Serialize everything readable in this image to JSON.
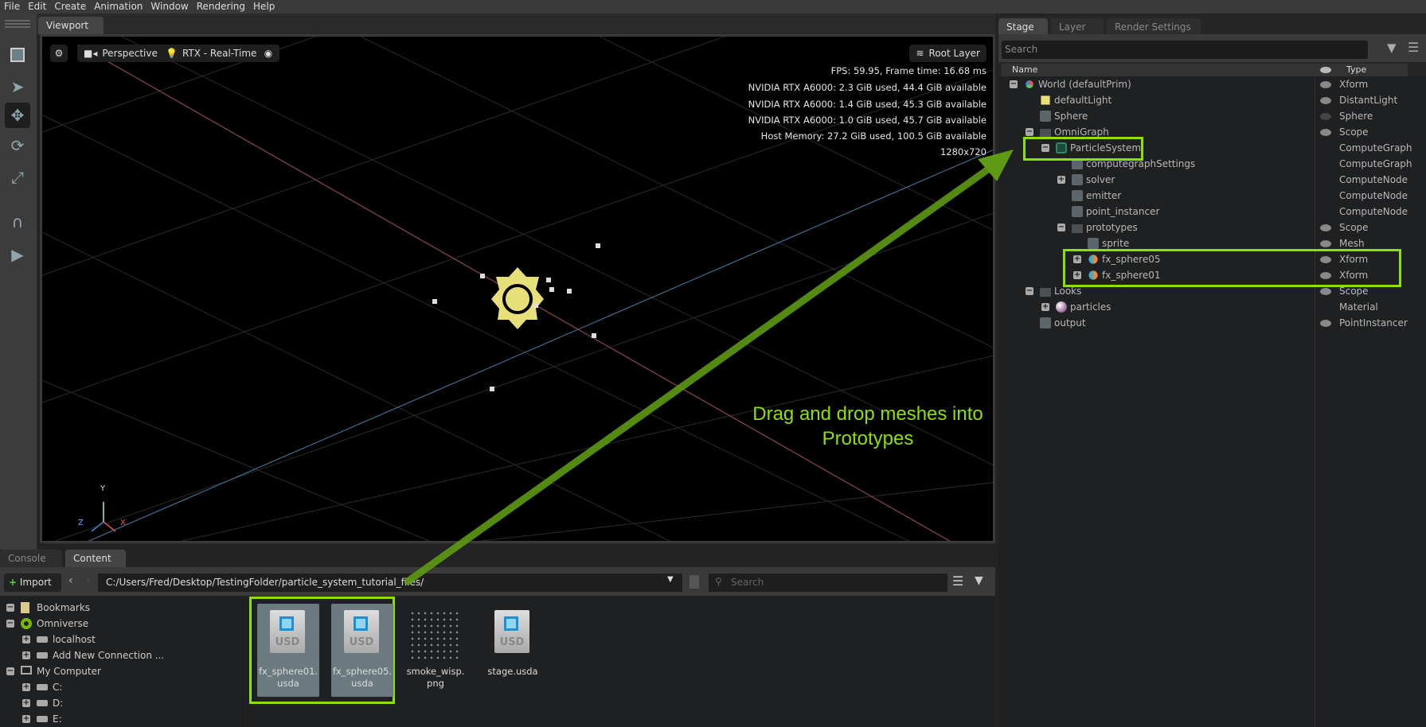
{
  "menu": [
    "File",
    "Edit",
    "Create",
    "Animation",
    "Window",
    "Rendering",
    "Help"
  ],
  "viewport": {
    "tab": "Viewport",
    "camera": "Perspective",
    "renderer": "RTX - Real-Time",
    "layer_button": "Root Layer",
    "stats": [
      "FPS: 59.95, Frame time: 16.68 ms",
      "NVIDIA RTX A6000: 2.3 GiB used,  44.4 GiB available",
      "NVIDIA RTX A6000: 1.4 GiB used,  45.3 GiB available",
      "NVIDIA RTX A6000: 1.0 GiB used,  45.7 GiB available",
      "Host Memory: 27.2 GiB used, 100.5 GiB available",
      "1280x720"
    ],
    "axes": {
      "y": "Y",
      "z": "Z",
      "x": "X"
    }
  },
  "annotation": {
    "line1": "Drag and drop meshes into",
    "line2": "Prototypes",
    "color": "#8ee000"
  },
  "stage": {
    "tabs": [
      "Stage",
      "Layer",
      "Render Settings"
    ],
    "search_placeholder": "Search",
    "col_name": "Name",
    "col_type": "Type",
    "rows": [
      {
        "name": "World (defaultPrim)",
        "type": "Xform",
        "level": 0,
        "exp": "-",
        "icon": "xform-axes-icon",
        "eye": "on"
      },
      {
        "name": "defaultLight",
        "type": "DistantLight",
        "level": 1,
        "exp": "",
        "icon": "light-icon",
        "eye": "on"
      },
      {
        "name": "Sphere",
        "type": "Sphere",
        "level": 1,
        "exp": "",
        "icon": "cube-icon",
        "eye": "off"
      },
      {
        "name": "OmniGraph",
        "type": "Scope",
        "level": 1,
        "exp": "-",
        "icon": "folder-icon",
        "eye": "on"
      },
      {
        "name": "ParticleSystem",
        "type": "ComputeGraph",
        "level": 2,
        "exp": "-",
        "icon": "graph-icon",
        "eye": ""
      },
      {
        "name": "computegraphSettings",
        "type": "ComputeGraphSe",
        "level": 3,
        "exp": "",
        "icon": "cube-icon",
        "eye": ""
      },
      {
        "name": "solver",
        "type": "ComputeNode",
        "level": 3,
        "exp": "+",
        "icon": "cube-icon",
        "eye": ""
      },
      {
        "name": "emitter",
        "type": "ComputeNode",
        "level": 3,
        "exp": "",
        "icon": "cube-icon",
        "eye": ""
      },
      {
        "name": "point_instancer",
        "type": "ComputeNode",
        "level": 3,
        "exp": "",
        "icon": "cube-icon",
        "eye": ""
      },
      {
        "name": "prototypes",
        "type": "Scope",
        "level": 3,
        "exp": "-",
        "icon": "folder-icon",
        "eye": "on"
      },
      {
        "name": "sprite",
        "type": "Mesh",
        "level": 4,
        "exp": "",
        "icon": "cube-icon",
        "eye": "on"
      },
      {
        "name": "fx_sphere05",
        "type": "Xform",
        "level": 4,
        "exp": "+",
        "icon": "xform-icon",
        "eye": "on"
      },
      {
        "name": "fx_sphere01",
        "type": "Xform",
        "level": 4,
        "exp": "+",
        "icon": "xform-icon",
        "eye": "on"
      },
      {
        "name": "Looks",
        "type": "Scope",
        "level": 1,
        "exp": "-",
        "icon": "folder-icon",
        "eye": "on"
      },
      {
        "name": "particles",
        "type": "Material",
        "level": 2,
        "exp": "+",
        "icon": "material-sphere-icon",
        "eye": ""
      },
      {
        "name": "output",
        "type": "PointInstancer",
        "level": 1,
        "exp": "",
        "icon": "cube-icon",
        "eye": "on"
      }
    ]
  },
  "content": {
    "tabs": [
      "Console",
      "Content"
    ],
    "import_label": "Import",
    "path": "C:/Users/Fred/Desktop/TestingFolder/particle_system_tutorial_files/",
    "search_placeholder": "Search",
    "tree": [
      {
        "label": "Bookmarks",
        "level": 0,
        "exp": "-",
        "icon": "bookmark-icon"
      },
      {
        "label": "Omniverse",
        "level": 0,
        "exp": "-",
        "icon": "omniverse-icon"
      },
      {
        "label": "localhost",
        "level": 1,
        "exp": "+",
        "icon": "server-icon"
      },
      {
        "label": "Add New Connection ...",
        "level": 1,
        "exp": "+",
        "icon": "add-connection-icon"
      },
      {
        "label": "My Computer",
        "level": 0,
        "exp": "-",
        "icon": "computer-icon"
      },
      {
        "label": "C:",
        "level": 1,
        "exp": "+",
        "icon": "drive-icon"
      },
      {
        "label": "D:",
        "level": 1,
        "exp": "+",
        "icon": "drive-icon"
      },
      {
        "label": "E:",
        "level": 1,
        "exp": "+",
        "icon": "drive-icon"
      }
    ],
    "files": [
      {
        "line1": "fx_sphere01.",
        "line2": "usda",
        "kind": "usd",
        "selected": true
      },
      {
        "line1": "fx_sphere05.",
        "line2": "usda",
        "kind": "usd",
        "selected": true
      },
      {
        "line1": "smoke_wisp.",
        "line2": "png",
        "kind": "image",
        "selected": false
      },
      {
        "line1": "stage.usda",
        "line2": "",
        "kind": "usd",
        "selected": false
      }
    ]
  }
}
